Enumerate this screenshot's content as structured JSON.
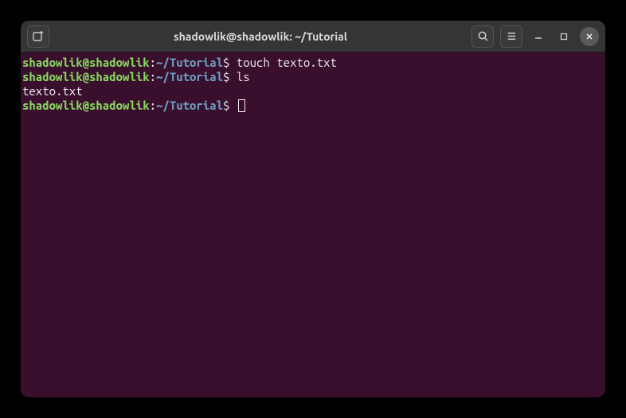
{
  "window": {
    "title": "shadowlik@shadowlik: ~/Tutorial"
  },
  "prompt": {
    "user_host": "shadowlik@shadowlik",
    "separator": ":",
    "path": "~/Tutorial",
    "symbol": "$ "
  },
  "lines": [
    {
      "type": "prompt",
      "command": "touch texto.txt"
    },
    {
      "type": "prompt",
      "command": "ls"
    },
    {
      "type": "output",
      "text": "texto.txt"
    },
    {
      "type": "prompt",
      "command": "",
      "cursor": true
    }
  ],
  "icons": {
    "new_tab": "new-tab",
    "search": "search",
    "menu": "menu",
    "minimize": "minimize",
    "maximize": "maximize",
    "close": "close"
  }
}
